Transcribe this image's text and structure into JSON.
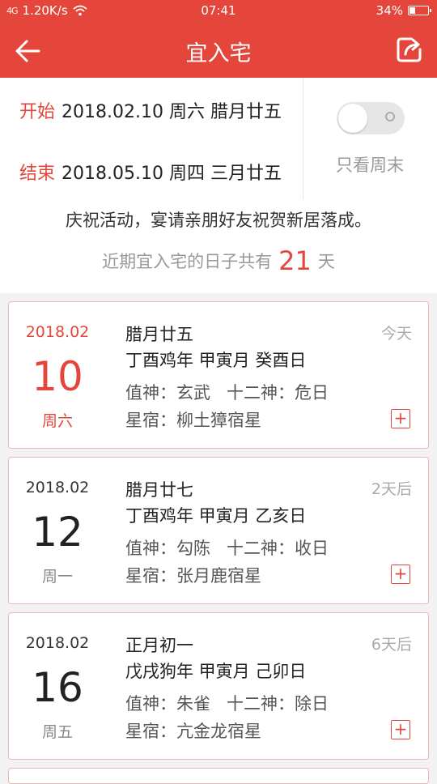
{
  "status_bar": {
    "signal": "4G",
    "speed": "1.20K/s",
    "time": "07:41",
    "battery": "34%",
    "battery_level": 0.34
  },
  "header": {
    "title": "宜入宅"
  },
  "range": {
    "start_label": "开始",
    "start_value": "2018.02.10 周六 腊月廿五",
    "end_label": "结束",
    "end_value": "2018.05.10 周四 三月廿五",
    "weekend_label": "只看周末",
    "weekend_only": false
  },
  "info": {
    "description": "庆祝活动，宴请亲朋好友祝贺新居落成。",
    "count_prefix": "近期宜入宅的日子共有",
    "count_value": "21",
    "count_suffix": "天"
  },
  "days": [
    {
      "year_month": "2018.02",
      "day": "10",
      "weekday": "周六",
      "lunar": "腊月廿五",
      "ganzhi": "丁酉鸡年 甲寅月 癸酉日",
      "zhishen": "值神：玄武",
      "shier": "十二神：危日",
      "xiu": "星宿：柳土獐宿星",
      "relative": "今天"
    },
    {
      "year_month": "2018.02",
      "day": "12",
      "weekday": "周一",
      "lunar": "腊月廿七",
      "ganzhi": "丁酉鸡年 甲寅月 乙亥日",
      "zhishen": "值神：勾陈",
      "shier": "十二神：收日",
      "xiu": "星宿：张月鹿宿星",
      "relative": "2天后"
    },
    {
      "year_month": "2018.02",
      "day": "16",
      "weekday": "周五",
      "lunar": "正月初一",
      "ganzhi": "戊戌狗年 甲寅月 己卯日",
      "zhishen": "值神：朱雀",
      "shier": "十二神：除日",
      "xiu": "星宿：亢金龙宿星",
      "relative": "6天后"
    }
  ],
  "add_label": "+",
  "colors": {
    "accent": "#e5463b",
    "background": "#f2f2f2"
  },
  "icons": {
    "back": "arrow-left-icon",
    "share": "share-icon",
    "wifi": "wifi-icon"
  }
}
